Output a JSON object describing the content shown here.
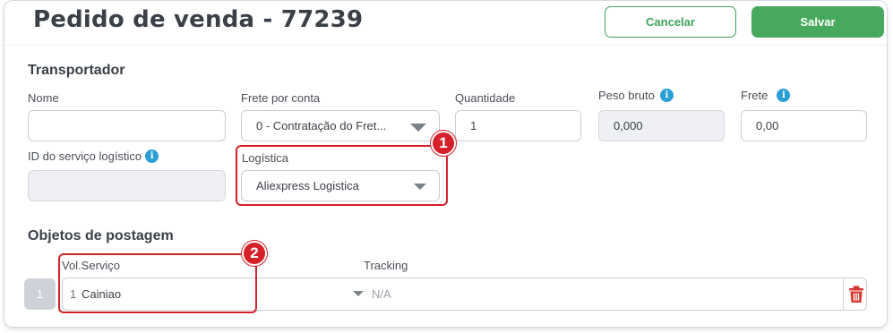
{
  "header": {
    "title": "Pedido de venda - 77239",
    "cancel_label": "Cancelar",
    "save_label": "Salvar"
  },
  "transportador": {
    "section_title": "Transportador",
    "nome": {
      "label": "Nome",
      "value": ""
    },
    "frete_por_conta": {
      "label": "Frete por conta",
      "value": "0 - Contratação do Fret..."
    },
    "quantidade": {
      "label": "Quantidade",
      "value": "1"
    },
    "peso_bruto": {
      "label": "Peso bruto",
      "value": "0,000"
    },
    "frete": {
      "label": "Frete",
      "value": "0,00"
    },
    "id_servico_logistico": {
      "label": "ID do serviço logístico",
      "value": ""
    },
    "logistica": {
      "label": "Logística",
      "value": "Aliexpress Logistica"
    }
  },
  "objetos_postagem": {
    "section_title": "Objetos de postagem",
    "col_vol_servico": "Vol.Serviço",
    "col_tracking": "Tracking",
    "rows": [
      {
        "row_number": "1",
        "vol": "1",
        "servico": "Cainiao",
        "tracking": "N/A"
      }
    ]
  },
  "annotations": {
    "badge_1": "1",
    "badge_2": "2"
  },
  "icons": {
    "info": "info-icon",
    "trash": "trash-icon",
    "dropdown": "chevron-down-icon"
  },
  "colors": {
    "accent_green": "#47a95d",
    "info_blue": "#2a9fd6",
    "highlight_red": "#d6202a",
    "delete_red": "#d9342b"
  }
}
